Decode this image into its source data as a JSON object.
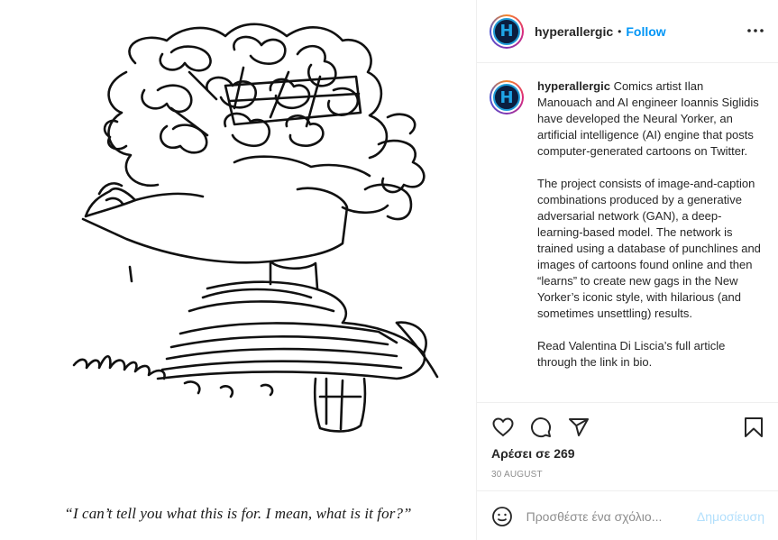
{
  "media": {
    "caption": "“I can’t tell you what this is for. I mean, what is it for?”"
  },
  "header": {
    "username": "hyperallergic",
    "separator": "•",
    "follow_label": "Follow",
    "avatar_letter": "H"
  },
  "post": {
    "username": "hyperallergic",
    "paragraphs": [
      "Comics artist Ilan Manouach and AI engineer Ioannis Siglidis have developed the Neural Yorker, an artificial intelligence (AI) engine that posts computer-generated cartoons on Twitter.",
      "The project consists of image-and-caption combinations produced by a generative adversarial network (GAN), a deep-learning-based model. The network is trained using a database of punchlines and images of cartoons found online and then “learns” to create new gags in the New Yorker’s iconic style, with hilarious (and sometimes unsettling) results.",
      "Read Valentina Di Liscia’s full article through the link in bio."
    ]
  },
  "actions": {
    "likes_text": "Αρέσει σε 269",
    "date": "30 AUGUST"
  },
  "comment_box": {
    "placeholder": "Προσθέστε ένα σχόλιο...",
    "post_label": "Δημοσίευση"
  },
  "icons": {
    "like": "heart-icon",
    "comment": "speech-bubble-icon",
    "share": "paper-plane-icon",
    "save": "bookmark-icon",
    "more": "more-dots-icon",
    "emoji": "smiley-icon"
  },
  "colors": {
    "follow": "#0095f6",
    "avatar_bg": "#0b1e3f",
    "avatar_letter": "#1ea5e6",
    "post_disabled": "#b2dffc"
  }
}
